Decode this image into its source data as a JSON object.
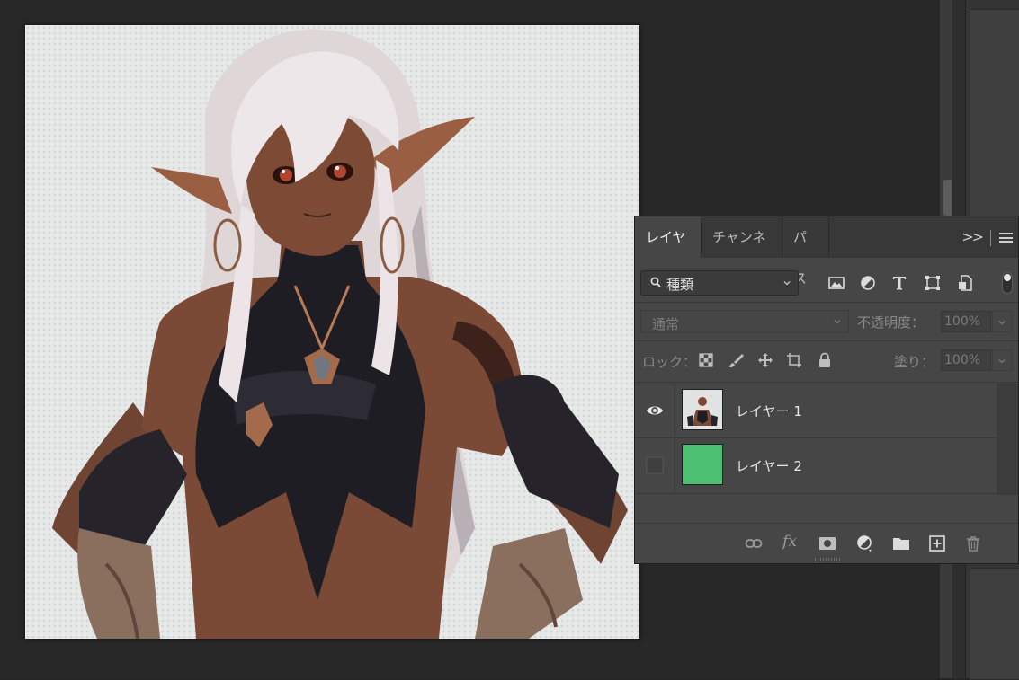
{
  "canvas": {
    "artwork": "image"
  },
  "layers_panel": {
    "tabs": [
      {
        "label": "レイヤー",
        "active": true
      },
      {
        "label": "チャンネル",
        "active": false
      },
      {
        "label": "パス",
        "active": false
      }
    ],
    "more_label": ">>",
    "filter": {
      "label": "種類",
      "icons": [
        "image-filter-icon",
        "adjustment-filter-icon",
        "type-filter-icon",
        "shape-filter-icon",
        "smart-object-filter-icon"
      ]
    },
    "blend_mode": "通常",
    "opacity_label": "不透明度：",
    "opacity_value": "100%",
    "lock_label": "ロック：",
    "lock_icons": [
      "lock-transparent-icon",
      "lock-paint-icon",
      "lock-move-icon",
      "lock-artboard-icon",
      "lock-all-icon"
    ],
    "fill_label": "塗り：",
    "fill_value": "100%",
    "layers": [
      {
        "name": "レイヤー 1",
        "visible": true,
        "thumbnail": "character-art"
      },
      {
        "name": "レイヤー 2",
        "visible": false,
        "thumbnail": "solid-fill",
        "fill_color": "#4cbf73"
      }
    ],
    "footer_icons": [
      "link-layers-icon",
      "fx-icon",
      "layer-mask-icon",
      "adjustment-layer-icon",
      "group-folder-icon",
      "new-layer-icon",
      "delete-layer-icon"
    ],
    "footer_fx_label": "fx"
  },
  "colors": {
    "app_bg": "#262626",
    "panel_bg": "#464646",
    "tabbar_bg": "#383838",
    "layer2_fill": "#4cbf73"
  }
}
